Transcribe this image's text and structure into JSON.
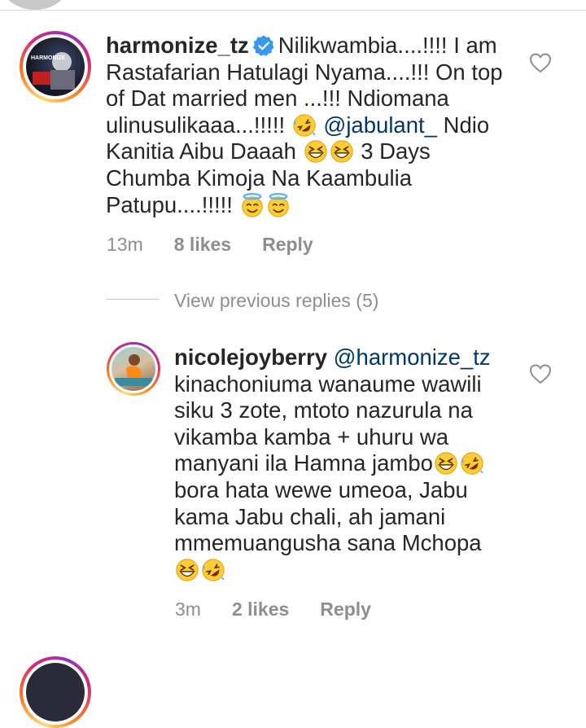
{
  "comment1": {
    "username": "harmonize_tz",
    "text_part1": "Nilikwambia....!!!! I am Rastafarian Hatulagi Nyama....!!! On top of Dat married men ...!!! Ndiomana ulinusulikaaa...!!!!! ",
    "mention": "@jabulant_",
    "text_part2": "Ndio Kanitia Aibu Daaah ",
    "text_part3": " 3 Days Chumba Kimoja Na Kaambulia Patupu....!!!!! ",
    "time": "13m",
    "likes": "8 likes",
    "reply": "Reply",
    "avatar_text": "HARMONIZE"
  },
  "view_previous": "View previous replies (5)",
  "reply1": {
    "username": "nicolejoyberry",
    "mention": "@harmonize_tz",
    "text_part1": "kinachoniuma wanaume wawili siku 3 zote, mtoto nazurula na vikamba kamba + uhuru wa manyani ila Hamna jambo",
    "text_part2": "bora hata wewe umeoa, Jabu kama Jabu chali, ah jamani mmemuangusha sana Mchopa",
    "time": "3m",
    "likes": "2 likes",
    "reply": "Reply"
  },
  "icons": {
    "heart": "heart-icon",
    "verified": "verified-badge-icon",
    "rofl": "rolling-on-floor-laughing-emoji",
    "grin": "grinning-squinting-face-emoji",
    "halo": "smiling-face-with-halo-emoji"
  },
  "colors": {
    "verified_blue": "#3897f0",
    "mention": "#00376b",
    "meta": "#8e8e8e"
  }
}
